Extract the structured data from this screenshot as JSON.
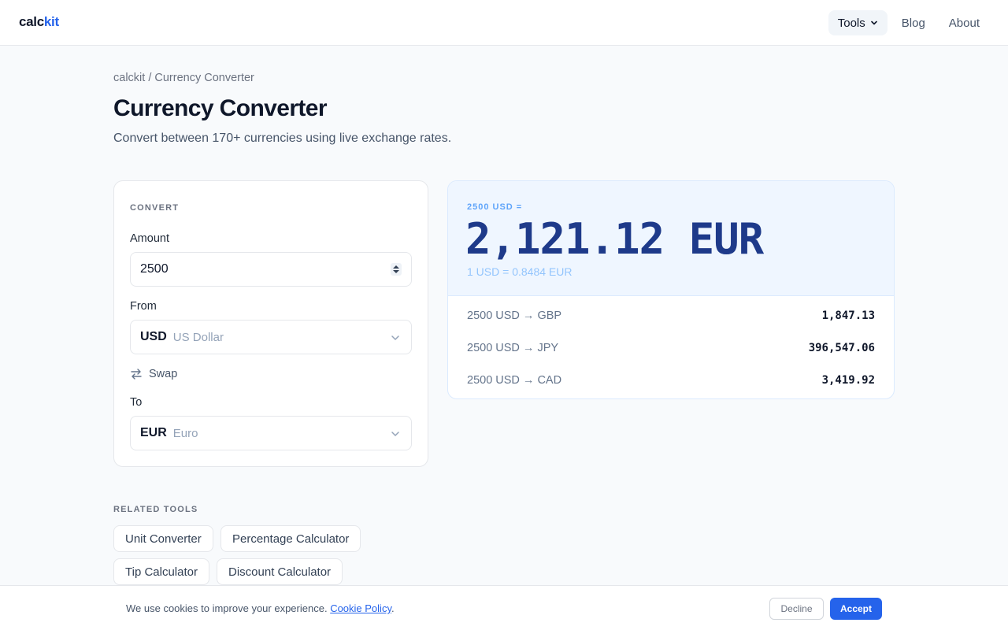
{
  "header": {
    "logo_main": "calc",
    "logo_accent": "kit",
    "nav": [
      {
        "label": "Tools",
        "active": true,
        "has_dropdown": true,
        "icon": "chevron-down-icon"
      },
      {
        "label": "Blog",
        "active": false
      },
      {
        "label": "About",
        "active": false
      }
    ]
  },
  "breadcrumb": "calckit / Currency Converter",
  "page": {
    "title": "Currency Converter",
    "subtitle": "Convert between 170+ currencies using live exchange rates."
  },
  "converter": {
    "heading": "CONVERT",
    "amount_label": "Amount",
    "amount_value": "2500",
    "from_label": "From",
    "from_code": "USD",
    "from_name": "US Dollar",
    "swap_label": "Swap",
    "swap_icon": "swap-icon",
    "to_label": "To",
    "to_code": "EUR",
    "to_name": "Euro"
  },
  "result": {
    "equation": "2500 USD =",
    "amount": "2,121.12 EUR",
    "rate": "1 USD = 0.8484 EUR",
    "conversions": [
      {
        "label": "2500 USD → GBP",
        "value": "1,847.13"
      },
      {
        "label": "2500 USD → JPY",
        "value": "396,547.06"
      },
      {
        "label": "2500 USD → CAD",
        "value": "3,419.92"
      }
    ]
  },
  "related": {
    "heading": "RELATED TOOLS",
    "tools": [
      "Unit Converter",
      "Percentage Calculator",
      "Tip Calculator",
      "Discount Calculator"
    ]
  },
  "cookie": {
    "text": "We use cookies to improve your experience.",
    "link": "Cookie Policy",
    "suffix": ".",
    "decline": "Decline",
    "accept": "Accept"
  },
  "colors": {
    "accent": "#2563eb",
    "result_bg": "#eff6ff",
    "result_text": "#1e3a8a"
  }
}
